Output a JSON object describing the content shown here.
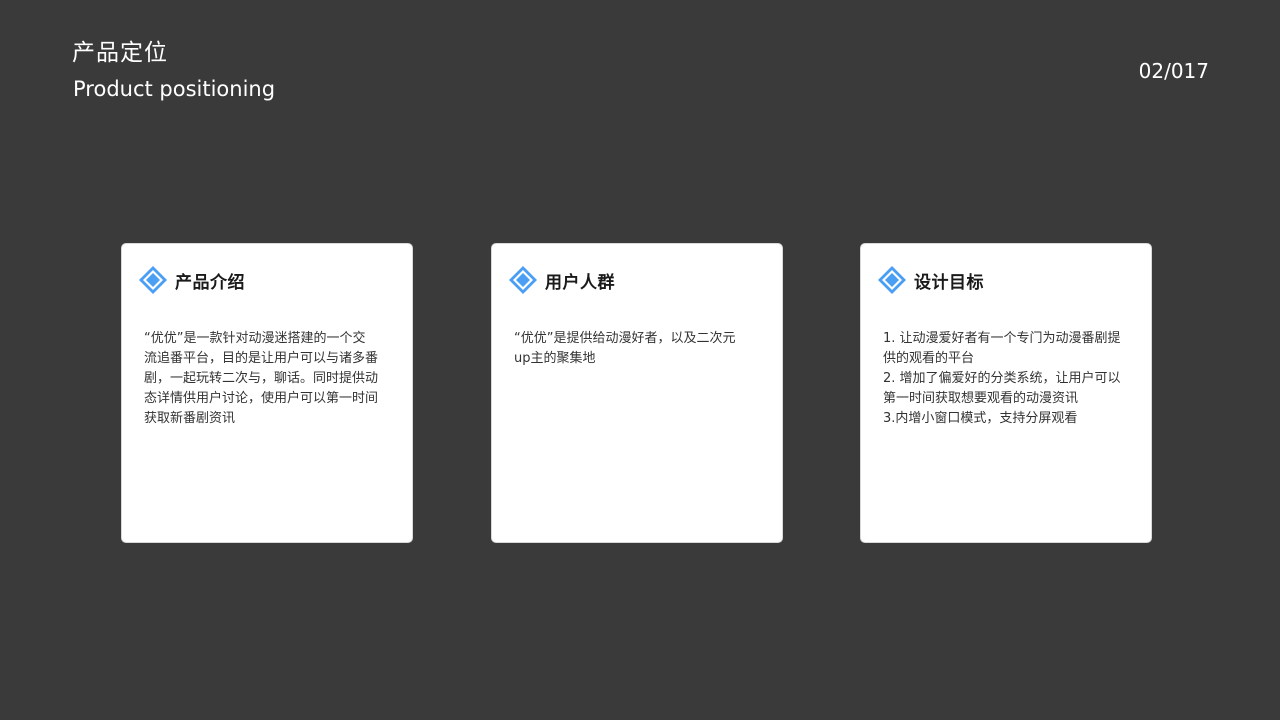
{
  "header": {
    "title": "产品定位",
    "subtitle": "Product positioning",
    "page_counter": "02/017"
  },
  "colors": {
    "background": "#3a3a3a",
    "card_bg": "#ffffff",
    "accent_blue": "#4a9ff5"
  },
  "cards": [
    {
      "icon": "diamond-icon",
      "title": "产品介绍",
      "lines": [
        "“优优”是一款针对动漫迷搭建的一个交",
        "流追番平台，目的是让用户可以与诸多番",
        "剧，一起玩转二次与，聊话。同时提供动",
        "态详情供用户讨论，使用户可以第一时间",
        "获取新番剧资讯"
      ]
    },
    {
      "icon": "diamond-icon",
      "title": "用户人群",
      "lines": [
        "“优优”是提供给动漫好者，以及二次元",
        "up主的聚集地"
      ]
    },
    {
      "icon": "diamond-icon",
      "title": "设计目标",
      "lines": [
        "1. 让动漫爱好者有一个专门为动漫番剧提",
        "供的观看的平台",
        "2. 增加了偏爱好的分类系统，让用户可以",
        "第一时间获取想要观看的动漫资讯",
        "3.内增小窗口模式，支持分屏观看"
      ]
    }
  ]
}
